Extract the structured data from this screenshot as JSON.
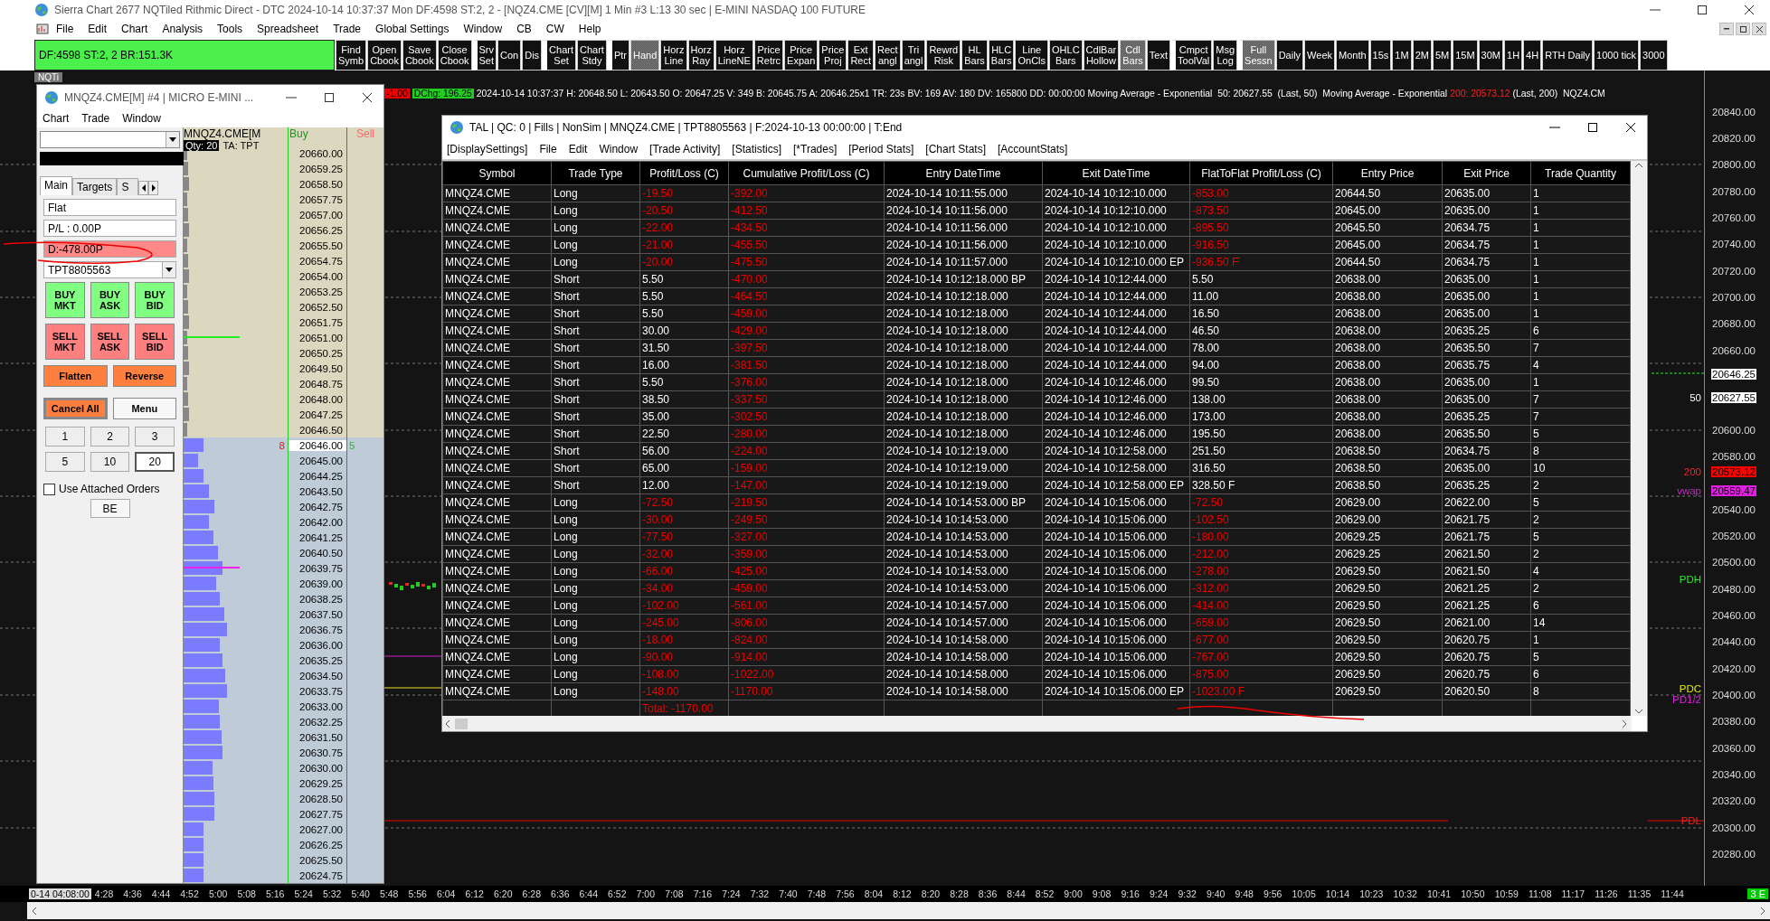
{
  "window": {
    "title": "Sierra Chart 2677 NQTiled Rithmic Direct - DTC 2024-10-14  10:37:37 Mon DF:4598  ST:2, 2 - [NQZ4.CME [CV][M]  1 Min  #3 L:13 30 sec | E-MINI NASDAQ 100 FUTURE"
  },
  "menu": [
    "File",
    "Edit",
    "Chart",
    "Analysis",
    "Tools",
    "Spreadsheet",
    "Trade",
    "Global Settings",
    "Window",
    "CB",
    "CW",
    "Help"
  ],
  "toolbar": {
    "status": "DF:4598  ST:2, 2  BR:151.3K",
    "buttons": [
      {
        "label": "Find\nSymb",
        "selected": false,
        "gap": false
      },
      {
        "label": "Open\nCbook",
        "selected": false,
        "gap": false
      },
      {
        "label": "Save\nCbook",
        "selected": false,
        "gap": false
      },
      {
        "label": "Close\nCbook",
        "selected": false,
        "gap": false
      },
      {
        "label": "Srv\nSet",
        "selected": false,
        "gap": true
      },
      {
        "label": "Con",
        "selected": false,
        "gap": false
      },
      {
        "label": "Dis",
        "selected": false,
        "gap": false
      },
      {
        "label": "Chart\nSet",
        "selected": false,
        "gap": true
      },
      {
        "label": "Chart\nStdy",
        "selected": false,
        "gap": false
      },
      {
        "label": "Ptr",
        "selected": false,
        "gap": true
      },
      {
        "label": "Hand",
        "selected": true,
        "gap": false
      },
      {
        "label": "Horz\nLine",
        "selected": false,
        "gap": false
      },
      {
        "label": "Horz\nRay",
        "selected": false,
        "gap": false
      },
      {
        "label": "Horz\nLineNE",
        "selected": false,
        "gap": false
      },
      {
        "label": "Price\nRetrc",
        "selected": false,
        "gap": false
      },
      {
        "label": "Price\nExpan",
        "selected": false,
        "gap": false
      },
      {
        "label": "Price\nProj",
        "selected": false,
        "gap": false
      },
      {
        "label": "Ext\nRect",
        "selected": false,
        "gap": false
      },
      {
        "label": "Rect\nangl",
        "selected": false,
        "gap": false
      },
      {
        "label": "Tri\nangl",
        "selected": false,
        "gap": false
      },
      {
        "label": "Rewrd\nRisk",
        "selected": false,
        "gap": false
      },
      {
        "label": "HL\nBars",
        "selected": false,
        "gap": false
      },
      {
        "label": "HLC\nBars",
        "selected": false,
        "gap": false
      },
      {
        "label": "Line\nOnCls",
        "selected": false,
        "gap": false
      },
      {
        "label": "OHLC\nBars",
        "selected": false,
        "gap": false
      },
      {
        "label": "CdlBar\nHollow",
        "selected": false,
        "gap": false
      },
      {
        "label": "Cdl\nBars",
        "selected": true,
        "gap": false
      },
      {
        "label": "Text",
        "selected": false,
        "gap": false
      },
      {
        "label": "Cmpct\nToolVal",
        "selected": false,
        "gap": true
      },
      {
        "label": "Msg\nLog",
        "selected": false,
        "gap": false
      },
      {
        "label": "Full\nSessn",
        "selected": true,
        "gap": true
      },
      {
        "label": "Daily",
        "selected": false,
        "gap": false
      },
      {
        "label": "Week",
        "selected": false,
        "gap": false
      },
      {
        "label": "Month",
        "selected": false,
        "gap": false
      },
      {
        "label": "15s",
        "selected": false,
        "gap": false
      },
      {
        "label": "1M",
        "selected": false,
        "gap": false
      },
      {
        "label": "2M",
        "selected": false,
        "gap": false
      },
      {
        "label": "5M",
        "selected": false,
        "gap": false
      },
      {
        "label": "15M",
        "selected": false,
        "gap": false
      },
      {
        "label": "30M",
        "selected": false,
        "gap": false
      },
      {
        "label": "1H",
        "selected": false,
        "gap": false
      },
      {
        "label": "4H",
        "selected": false,
        "gap": false
      },
      {
        "label": "RTH Daily",
        "selected": false,
        "gap": false
      },
      {
        "label": "1000 tick",
        "selected": false,
        "gap": false
      },
      {
        "label": "3000",
        "selected": false,
        "gap": false
      }
    ]
  },
  "chart": {
    "tab": "NQTi",
    "info_line": [
      {
        "kind": "loss-box",
        "text": "-1.00"
      },
      {
        "kind": "gain-box",
        "text": "DChg: 196.25"
      },
      {
        "kind": "plain",
        "text": "2024-10-14 10:37:37 H: 20648.50 L: 20643.50 O: 20647.25 V: 349 B: 20645.75 A: 20646.25x1 TR: 23s BV: 169 AV: 180 DV: 165800 DD: 00:00:00 Moving Average - Exponential  50: 20627.55  (Last, 50)  Moving Average - Exponential"
      },
      {
        "kind": "alert",
        "text": "200: 20573.12"
      },
      {
        "kind": "plain",
        "text": "(Last, 200)  NQZ4.CM"
      }
    ],
    "price_axis_upper": [
      "20840.00",
      "20820.00",
      "20800.00",
      "20780.00",
      "20760.00",
      "20740.00",
      "20720.00",
      "20700.00",
      "20680.00",
      "20660.00"
    ],
    "price_axis_middle": [
      "20600.00",
      "20580.00"
    ],
    "price_axis_lower": [
      "20540.00",
      "20520.00",
      "20500.00",
      "20480.00",
      "20460.00",
      "20440.00",
      "20420.00",
      "20400.00",
      "20380.00",
      "20360.00",
      "20340.00",
      "20320.00",
      "20300.00",
      "20280.00"
    ],
    "markers": [
      {
        "kind": "last",
        "value": "20646.25"
      },
      {
        "kind": "ma50",
        "label": "50",
        "value": "20627.55"
      },
      {
        "kind": "ma200",
        "label": "200",
        "value": "20573.12"
      },
      {
        "kind": "vwap",
        "label": "vwap",
        "value": "20559.47"
      }
    ],
    "levels": [
      {
        "label": "PDH",
        "kind": "pdh"
      },
      {
        "label": "PDC",
        "kind": "pdc"
      },
      {
        "label": "PD1/2",
        "kind": "mid"
      },
      {
        "label": "PDL",
        "kind": "pdl"
      }
    ],
    "time_axis": {
      "cursor": "0-14  04:08:00",
      "labels": [
        "4:28",
        "4:36",
        "4:44",
        "4:52",
        "5:00",
        "5:08",
        "5:16",
        "5:24",
        "5:32",
        "5:40",
        "5:48",
        "5:56",
        "6:04",
        "6:12",
        "6:20",
        "6:28",
        "6:36",
        "6:44",
        "6:52",
        "7:00",
        "7:08",
        "7:16",
        "7:24",
        "7:32",
        "7:40",
        "7:48",
        "7:56",
        "8:04",
        "8:12",
        "8:20",
        "8:28",
        "8:36",
        "8:44",
        "8:52",
        "9:00",
        "9:08",
        "9:16",
        "9:24",
        "9:32",
        "9:40",
        "9:48",
        "9:56",
        "10:05",
        "10:14",
        "10:23",
        "10:32",
        "10:41",
        "10:50",
        "10:59",
        "11:08",
        "11:17",
        "11:26",
        "11:35",
        "11:44"
      ]
    },
    "corner_badge": "3 E"
  },
  "dom_window": {
    "title": "MNQZ4.CME[M] #4 | MICRO E-MINI ...",
    "menu": [
      "Chart",
      "Trade",
      "Window"
    ],
    "order_panel": {
      "tabs": [
        {
          "label": "Main",
          "selected": true
        },
        {
          "label": "Targets",
          "selected": false
        },
        {
          "label": "S",
          "selected": false
        }
      ],
      "position": "Flat",
      "pl": "P/L : 0.00P",
      "daily_pl": "D:-478.00P",
      "account": "TPT8805563",
      "buttons": [
        {
          "label": "BUY\nMKT",
          "kind": "buy"
        },
        {
          "label": "BUY\nASK",
          "kind": "buy"
        },
        {
          "label": "BUY\nBID",
          "kind": "buy"
        },
        {
          "label": "SELL\nMKT",
          "kind": "sell"
        },
        {
          "label": "SELL\nASK",
          "kind": "sell"
        },
        {
          "label": "SELL\nBID",
          "kind": "sell"
        }
      ],
      "actions": [
        {
          "label": "Flatten",
          "kind": "action"
        },
        {
          "label": "Reverse",
          "kind": "action"
        },
        {
          "label": "Cancel All",
          "kind": "cancel"
        },
        {
          "label": "Menu",
          "kind": "plain"
        }
      ],
      "quantities": [
        {
          "label": "1",
          "selected": false
        },
        {
          "label": "2",
          "selected": false
        },
        {
          "label": "3",
          "selected": false
        },
        {
          "label": "5",
          "selected": false
        },
        {
          "label": "10",
          "selected": false
        },
        {
          "label": "20",
          "selected": true
        }
      ],
      "attached_orders": {
        "label": "Use Attached Orders",
        "checked": false
      },
      "be": "BE"
    },
    "ladder": {
      "symbol": "MNQZ4.CME[M",
      "buy": "Buy",
      "sell": "Sell",
      "qty": "Qty: 20",
      "ta": "TA: TPT",
      "upper": [
        "20660.00",
        "20659.25",
        "20658.50",
        "20657.75",
        "20657.00",
        "20656.25",
        "20655.50",
        "20654.75",
        "20654.00",
        "20653.25",
        "20652.50",
        "20651.75",
        "20651.00",
        "20650.25",
        "20649.50",
        "20648.75",
        "20648.00",
        "20647.25",
        "20646.50"
      ],
      "current": {
        "price": "20646.00",
        "bid_size": "8",
        "ask_size": "5"
      },
      "lower": [
        "20645.00",
        "20644.25",
        "20643.50",
        "20642.75",
        "20642.00",
        "20641.25",
        "20640.50",
        "20639.75",
        "20639.00",
        "20638.25",
        "20637.50",
        "20636.75",
        "20636.00",
        "20635.25",
        "20634.50",
        "20633.75",
        "20633.00",
        "20632.25",
        "20631.50",
        "20630.75",
        "20630.00",
        "20629.25",
        "20628.50",
        "20627.75",
        "20627.00",
        "20626.25",
        "20625.50",
        "20624.75"
      ]
    }
  },
  "tal_window": {
    "title": "TAL | QC: 0 | Fills | NonSim | MNQZ4.CME | TPT8805563 | F:2024-10-13  00:00:00 | T:End",
    "menu": [
      "[DisplaySettings]",
      "File",
      "Edit",
      "Window",
      "[Trade Activity]",
      "[Statistics]",
      "[*Trades]",
      "[Period Stats]",
      "[Chart Stats]",
      "[AccountStats]"
    ],
    "columns": [
      "Symbol",
      "Trade Type",
      "Profit/Loss (C)",
      "Cumulative Profit/Loss (C)",
      "Entry DateTime",
      "Exit DateTime",
      "FlatToFlat Profit/Loss (C)",
      "Entry Price",
      "Exit Price",
      "Trade Quantity"
    ],
    "rows": [
      {
        "cells": [
          "MNQZ4.CME",
          "Long",
          "-19.50",
          "-392.00",
          "2024-10-14  10:11:55.000",
          "2024-10-14  10:12:10.000",
          "-853.00",
          "20644.50",
          "20635.00",
          "1"
        ],
        "pl_loss": true,
        "cum_loss": true,
        "ftf_loss": true
      },
      {
        "cells": [
          "MNQZ4.CME",
          "Long",
          "-20.50",
          "-412.50",
          "2024-10-14  10:11:56.000",
          "2024-10-14  10:12:10.000",
          "-873.50",
          "20645.00",
          "20635.00",
          "1"
        ],
        "pl_loss": true,
        "cum_loss": true,
        "ftf_loss": true
      },
      {
        "cells": [
          "MNQZ4.CME",
          "Long",
          "-22.00",
          "-434.50",
          "2024-10-14  10:11:56.000",
          "2024-10-14  10:12:10.000",
          "-895.50",
          "20645.50",
          "20634.75",
          "1"
        ],
        "pl_loss": true,
        "cum_loss": true,
        "ftf_loss": true
      },
      {
        "cells": [
          "MNQZ4.CME",
          "Long",
          "-21.00",
          "-455.50",
          "2024-10-14  10:11:56.000",
          "2024-10-14  10:12:10.000",
          "-916.50",
          "20645.00",
          "20634.75",
          "1"
        ],
        "pl_loss": true,
        "cum_loss": true,
        "ftf_loss": true
      },
      {
        "cells": [
          "MNQZ4.CME",
          "Long",
          "-20.00",
          "-475.50",
          "2024-10-14  10:11:57.000",
          "2024-10-14  10:12:10.000 EP",
          "-936.50 F",
          "20644.50",
          "20634.75",
          "1"
        ],
        "pl_loss": true,
        "cum_loss": true,
        "ftf_loss": true
      },
      {
        "cells": [
          "MNQZ4.CME",
          "Short",
          "5.50",
          "-470.00",
          "2024-10-14  10:12:18.000 BP",
          "2024-10-14  10:12:44.000",
          "5.50",
          "20638.00",
          "20635.00",
          "1"
        ],
        "pl_loss": false,
        "cum_loss": true,
        "ftf_loss": false
      },
      {
        "cells": [
          "MNQZ4.CME",
          "Short",
          "5.50",
          "-464.50",
          "2024-10-14  10:12:18.000",
          "2024-10-14  10:12:44.000",
          "11.00",
          "20638.00",
          "20635.00",
          "1"
        ],
        "pl_loss": false,
        "cum_loss": true,
        "ftf_loss": false
      },
      {
        "cells": [
          "MNQZ4.CME",
          "Short",
          "5.50",
          "-459.00",
          "2024-10-14  10:12:18.000",
          "2024-10-14  10:12:44.000",
          "16.50",
          "20638.00",
          "20635.00",
          "1"
        ],
        "pl_loss": false,
        "cum_loss": true,
        "ftf_loss": false
      },
      {
        "cells": [
          "MNQZ4.CME",
          "Short",
          "30.00",
          "-429.00",
          "2024-10-14  10:12:18.000",
          "2024-10-14  10:12:44.000",
          "46.50",
          "20638.00",
          "20635.25",
          "6"
        ],
        "pl_loss": false,
        "cum_loss": true,
        "ftf_loss": false
      },
      {
        "cells": [
          "MNQZ4.CME",
          "Short",
          "31.50",
          "-397.50",
          "2024-10-14  10:12:18.000",
          "2024-10-14  10:12:44.000",
          "78.00",
          "20638.00",
          "20635.50",
          "7"
        ],
        "pl_loss": false,
        "cum_loss": true,
        "ftf_loss": false
      },
      {
        "cells": [
          "MNQZ4.CME",
          "Short",
          "16.00",
          "-381.50",
          "2024-10-14  10:12:18.000",
          "2024-10-14  10:12:44.000",
          "94.00",
          "20638.00",
          "20635.75",
          "4"
        ],
        "pl_loss": false,
        "cum_loss": true,
        "ftf_loss": false
      },
      {
        "cells": [
          "MNQZ4.CME",
          "Short",
          "5.50",
          "-376.00",
          "2024-10-14  10:12:18.000",
          "2024-10-14  10:12:46.000",
          "99.50",
          "20638.00",
          "20635.00",
          "1"
        ],
        "pl_loss": false,
        "cum_loss": true,
        "ftf_loss": false
      },
      {
        "cells": [
          "MNQZ4.CME",
          "Short",
          "38.50",
          "-337.50",
          "2024-10-14  10:12:18.000",
          "2024-10-14  10:12:46.000",
          "138.00",
          "20638.00",
          "20635.00",
          "7"
        ],
        "pl_loss": false,
        "cum_loss": true,
        "ftf_loss": false
      },
      {
        "cells": [
          "MNQZ4.CME",
          "Short",
          "35.00",
          "-302.50",
          "2024-10-14  10:12:18.000",
          "2024-10-14  10:12:46.000",
          "173.00",
          "20638.00",
          "20635.25",
          "7"
        ],
        "pl_loss": false,
        "cum_loss": true,
        "ftf_loss": false
      },
      {
        "cells": [
          "MNQZ4.CME",
          "Short",
          "22.50",
          "-280.00",
          "2024-10-14  10:12:18.000",
          "2024-10-14  10:12:46.000",
          "195.50",
          "20638.00",
          "20635.50",
          "5"
        ],
        "pl_loss": false,
        "cum_loss": true,
        "ftf_loss": false
      },
      {
        "cells": [
          "MNQZ4.CME",
          "Short",
          "56.00",
          "-224.00",
          "2024-10-14  10:12:19.000",
          "2024-10-14  10:12:58.000",
          "251.50",
          "20638.50",
          "20634.75",
          "8"
        ],
        "pl_loss": false,
        "cum_loss": true,
        "ftf_loss": false
      },
      {
        "cells": [
          "MNQZ4.CME",
          "Short",
          "65.00",
          "-159.00",
          "2024-10-14  10:12:19.000",
          "2024-10-14  10:12:58.000",
          "316.50",
          "20638.50",
          "20635.00",
          "10"
        ],
        "pl_loss": false,
        "cum_loss": true,
        "ftf_loss": false
      },
      {
        "cells": [
          "MNQZ4.CME",
          "Short",
          "12.00",
          "-147.00",
          "2024-10-14  10:12:19.000",
          "2024-10-14  10:12:58.000 EP",
          "328.50 F",
          "20638.50",
          "20635.25",
          "2"
        ],
        "pl_loss": false,
        "cum_loss": true,
        "ftf_loss": false
      },
      {
        "cells": [
          "MNQZ4.CME",
          "Long",
          "-72.50",
          "-219.50",
          "2024-10-14  10:14:53.000 BP",
          "2024-10-14  10:15:06.000",
          "-72.50",
          "20629.00",
          "20622.00",
          "5"
        ],
        "pl_loss": true,
        "cum_loss": true,
        "ftf_loss": true
      },
      {
        "cells": [
          "MNQZ4.CME",
          "Long",
          "-30.00",
          "-249.50",
          "2024-10-14  10:14:53.000",
          "2024-10-14  10:15:06.000",
          "-102.50",
          "20629.00",
          "20621.75",
          "2"
        ],
        "pl_loss": true,
        "cum_loss": true,
        "ftf_loss": true
      },
      {
        "cells": [
          "MNQZ4.CME",
          "Long",
          "-77.50",
          "-327.00",
          "2024-10-14  10:14:53.000",
          "2024-10-14  10:15:06.000",
          "-180.00",
          "20629.25",
          "20621.75",
          "5"
        ],
        "pl_loss": true,
        "cum_loss": true,
        "ftf_loss": true
      },
      {
        "cells": [
          "MNQZ4.CME",
          "Long",
          "-32.00",
          "-359.00",
          "2024-10-14  10:14:53.000",
          "2024-10-14  10:15:06.000",
          "-212.00",
          "20629.25",
          "20621.50",
          "2"
        ],
        "pl_loss": true,
        "cum_loss": true,
        "ftf_loss": true
      },
      {
        "cells": [
          "MNQZ4.CME",
          "Long",
          "-66.00",
          "-425.00",
          "2024-10-14  10:14:53.000",
          "2024-10-14  10:15:06.000",
          "-278.00",
          "20629.50",
          "20621.50",
          "4"
        ],
        "pl_loss": true,
        "cum_loss": true,
        "ftf_loss": true
      },
      {
        "cells": [
          "MNQZ4.CME",
          "Long",
          "-34.00",
          "-459.00",
          "2024-10-14  10:14:53.000",
          "2024-10-14  10:15:06.000",
          "-312.00",
          "20629.50",
          "20621.25",
          "2"
        ],
        "pl_loss": true,
        "cum_loss": true,
        "ftf_loss": true
      },
      {
        "cells": [
          "MNQZ4.CME",
          "Long",
          "-102.00",
          "-561.00",
          "2024-10-14  10:14:57.000",
          "2024-10-14  10:15:06.000",
          "-414.00",
          "20629.50",
          "20621.25",
          "6"
        ],
        "pl_loss": true,
        "cum_loss": true,
        "ftf_loss": true
      },
      {
        "cells": [
          "MNQZ4.CME",
          "Long",
          "-245.00",
          "-806.00",
          "2024-10-14  10:14:57.000",
          "2024-10-14  10:15:06.000",
          "-659.00",
          "20629.50",
          "20621.00",
          "14"
        ],
        "pl_loss": true,
        "cum_loss": true,
        "ftf_loss": true
      },
      {
        "cells": [
          "MNQZ4.CME",
          "Long",
          "-18.00",
          "-824.00",
          "2024-10-14  10:14:58.000",
          "2024-10-14  10:15:06.000",
          "-677.00",
          "20629.50",
          "20620.75",
          "1"
        ],
        "pl_loss": true,
        "cum_loss": true,
        "ftf_loss": true
      },
      {
        "cells": [
          "MNQZ4.CME",
          "Long",
          "-90.00",
          "-914.00",
          "2024-10-14  10:14:58.000",
          "2024-10-14  10:15:06.000",
          "-767.00",
          "20629.50",
          "20620.75",
          "5"
        ],
        "pl_loss": true,
        "cum_loss": true,
        "ftf_loss": true
      },
      {
        "cells": [
          "MNQZ4.CME",
          "Long",
          "-108.00",
          "-1022.00",
          "2024-10-14  10:14:58.000",
          "2024-10-14  10:15:06.000",
          "-875.00",
          "20629.50",
          "20620.75",
          "6"
        ],
        "pl_loss": true,
        "cum_loss": true,
        "ftf_loss": true
      },
      {
        "cells": [
          "MNQZ4.CME",
          "Long",
          "-148.00",
          "-1170.00",
          "2024-10-14  10:14:58.000",
          "2024-10-14  10:15:06.000 EP",
          "-1023.00 F",
          "20629.50",
          "20620.50",
          "8"
        ],
        "pl_loss": true,
        "cum_loss": true,
        "ftf_loss": true
      }
    ],
    "total": "Total: -1170.00"
  }
}
